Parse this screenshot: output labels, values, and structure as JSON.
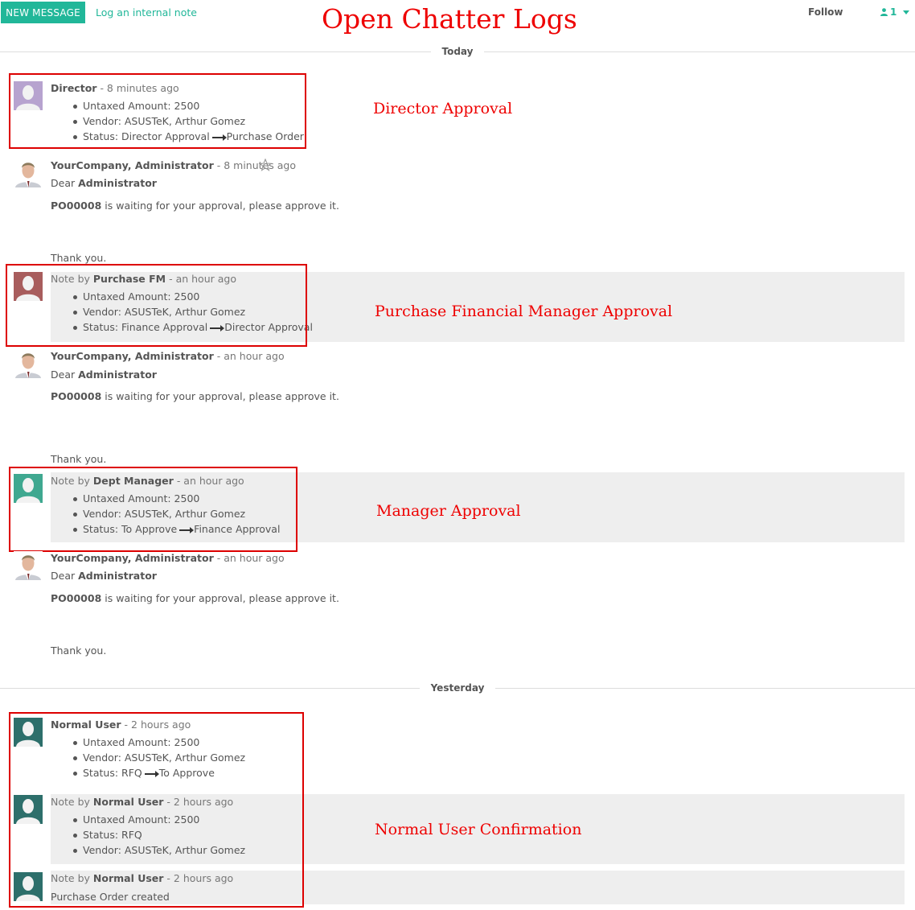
{
  "topbar": {
    "new_message": "NEW MESSAGE",
    "log_note": "Log an internal note",
    "follow": "Follow",
    "followers_count": "1"
  },
  "annotations": {
    "title": "Open Chatter Logs",
    "director": "Director Approval",
    "purchase_fm": "Purchase Financial Manager Approval",
    "manager": "Manager Approval",
    "normal_user": "Normal User Confirmation"
  },
  "separators": {
    "today": "Today",
    "yesterday": "Yesterday"
  },
  "messages": {
    "director": {
      "author": "Director",
      "time": "- 8 minutes ago",
      "lines": [
        "Untaxed Amount: 2500",
        "Vendor: ASUSTeK, Arthur Gomez"
      ],
      "status_prefix": "Status: Director Approval",
      "status_suffix": "Purchase Order"
    },
    "admin1": {
      "author": "YourCompany, Administrator",
      "time": "- 8 minutes ago",
      "dear": "Dear",
      "recipient": "Administrator",
      "ref": "PO00008",
      "waiting": "is waiting for your approval, please approve it.",
      "thanks": "Thank you."
    },
    "fm": {
      "note_by": "Note by",
      "author": "Purchase FM",
      "time": "- an hour ago",
      "lines": [
        "Untaxed Amount: 2500",
        "Vendor: ASUSTeK, Arthur Gomez"
      ],
      "status_prefix": "Status: Finance Approval",
      "status_suffix": "Director Approval"
    },
    "admin2": {
      "author": "YourCompany, Administrator",
      "time": "- an hour ago",
      "dear": "Dear",
      "recipient": "Administrator",
      "ref": "PO00008",
      "waiting": "is waiting for your approval, please approve it.",
      "thanks": "Thank you."
    },
    "dm": {
      "note_by": "Note by",
      "author": "Dept Manager",
      "time": "- an hour ago",
      "lines": [
        "Untaxed Amount: 2500",
        "Vendor: ASUSTeK, Arthur Gomez"
      ],
      "status_prefix": "Status: To Approve",
      "status_suffix": "Finance Approval"
    },
    "admin3": {
      "author": "YourCompany, Administrator",
      "time": "- an hour ago",
      "dear": "Dear",
      "recipient": "Administrator",
      "ref": "PO00008",
      "waiting": "is waiting for your approval, please approve it.",
      "thanks": "Thank you."
    },
    "nu1": {
      "author": "Normal User",
      "time": "- 2 hours ago",
      "lines": [
        "Untaxed Amount: 2500",
        "Vendor: ASUSTeK, Arthur Gomez"
      ],
      "status_prefix": "Status: RFQ",
      "status_suffix": "To Approve"
    },
    "nu2": {
      "note_by": "Note by",
      "author": "Normal User",
      "time": "- 2 hours ago",
      "lines": [
        "Untaxed Amount: 2500",
        "Status: RFQ",
        "Vendor: ASUSTeK, Arthur Gomez"
      ]
    },
    "nu3": {
      "note_by": "Note by",
      "author": "Normal User",
      "time": "- 2 hours ago",
      "body": "Purchase Order created"
    }
  },
  "colors": {
    "accent": "#21b799",
    "annotation": "#ee0000",
    "director_avatar": "#b7a3cf",
    "fm_avatar": "#a85d5d",
    "dm_avatar": "#3fa890",
    "normal_user_avatar": "#2d6f6b",
    "note_bg": "#eeeeee"
  },
  "icons": [
    "user-icon",
    "caret-down-icon",
    "star-icon",
    "arrow-right-icon",
    "avatar-placeholder-icon",
    "person-photo-icon"
  ]
}
